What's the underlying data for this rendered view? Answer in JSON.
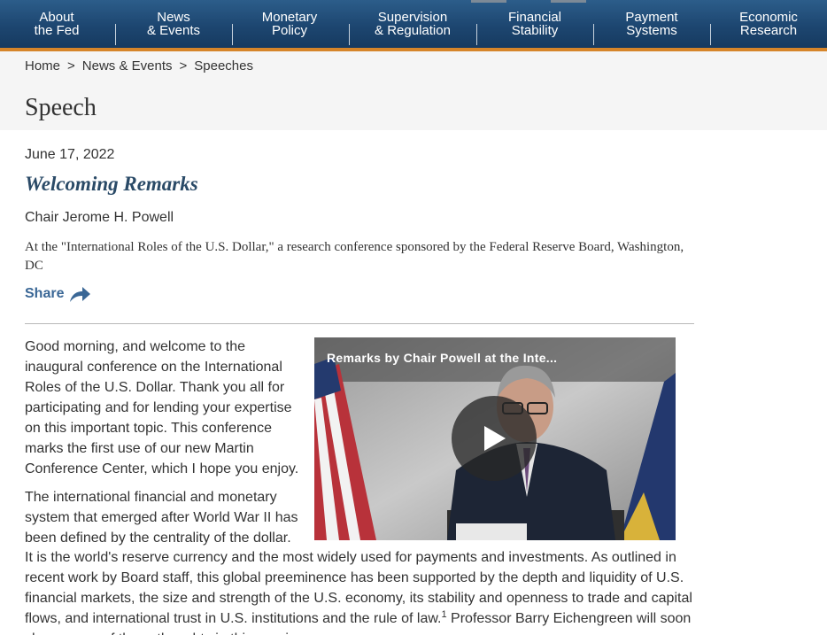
{
  "nav": {
    "items": [
      {
        "label": "About\nthe Fed"
      },
      {
        "label": "News\n& Events"
      },
      {
        "label": "Monetary\nPolicy"
      },
      {
        "label": "Supervision\n& Regulation"
      },
      {
        "label": "Financial\nStability"
      },
      {
        "label": "Payment\nSystems"
      },
      {
        "label": "Economic\nResearch"
      }
    ]
  },
  "breadcrumb": {
    "items": [
      "Home",
      "News & Events",
      "Speeches"
    ],
    "separator": ">"
  },
  "page": {
    "title": "Speech"
  },
  "speech": {
    "date": "June 17, 2022",
    "title": "Welcoming Remarks",
    "speaker": "Chair Jerome H. Powell",
    "location": "At the \"International Roles of the U.S. Dollar,\" a research conference sponsored by the Federal Reserve Board, Washington, DC",
    "share_label": "Share"
  },
  "video": {
    "title": "Remarks by Chair Powell at the Inte...",
    "play_icon": "play-icon"
  },
  "body": {
    "p1": "Good morning, and welcome to the inaugural conference on the International Roles of the U.S. Dollar. Thank you all for participating and for lending your expertise on this important topic. This conference marks the first use of our new Martin Conference Center, which I hope you enjoy.",
    "p2": "The international financial and monetary system that emerged after World War II has been defined by the centrality of the dollar.",
    "p3_a": "It is the world's reserve currency and the most widely used for payments and investments. As outlined in recent work by Board staff, this global preeminence has been supported by the depth and liquidity of U.S. financial markets, the size and strength of the U.S. economy, its stability and openness to trade and capital flows, and international trust in U.S. institutions and the rule of law.",
    "footnote": "1",
    "p3_b": " Professor Barry Eichengreen will soon share some of these thoughts in this session."
  },
  "colors": {
    "nav_blue": "#1d4670",
    "nav_accent": "#d6852a",
    "title_blue": "#2a4a67",
    "link_blue": "#3a6796"
  }
}
